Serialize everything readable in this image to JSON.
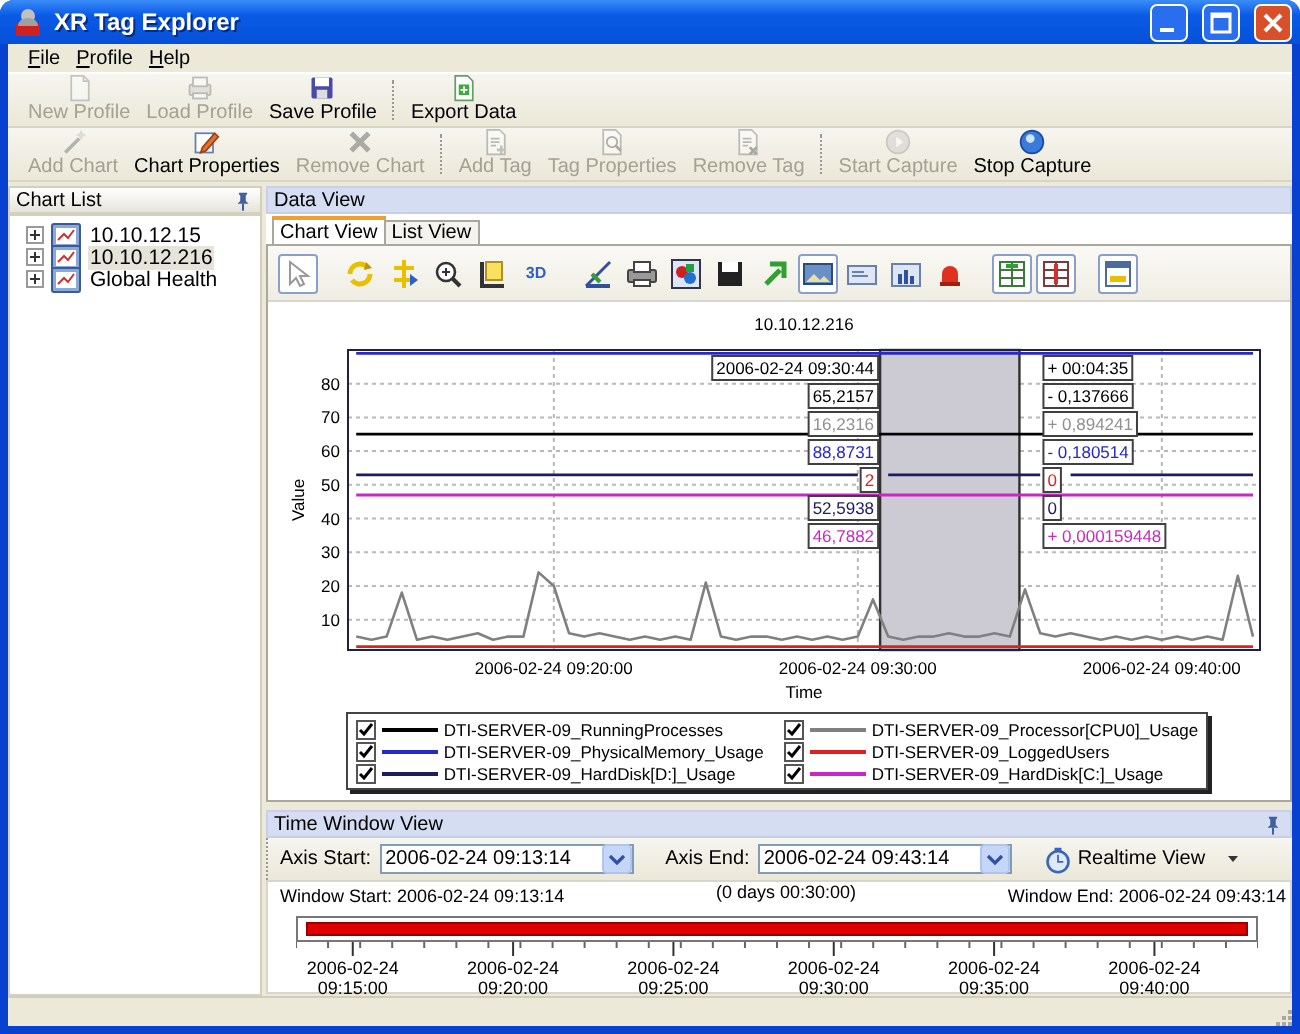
{
  "window": {
    "title": "XR Tag Explorer"
  },
  "menu": [
    "File",
    "Profile",
    "Help"
  ],
  "toolbar_profile": [
    [
      {
        "label": "New Profile",
        "kind": "doc",
        "disabled": true
      },
      {
        "label": "Load Profile",
        "kind": "tray",
        "disabled": true
      },
      {
        "label": "Save Profile",
        "kind": "save",
        "disabled": false
      }
    ],
    [
      {
        "label": "Export Data",
        "kind": "export",
        "disabled": false
      }
    ]
  ],
  "toolbar_chart": [
    [
      {
        "label": "Add Chart",
        "kind": "wand",
        "disabled": true
      },
      {
        "label": "Chart Properties",
        "kind": "pencil",
        "disabled": false
      },
      {
        "label": "Remove Chart",
        "kind": "remove",
        "disabled": true
      }
    ],
    [
      {
        "label": "Add Tag",
        "kind": "tagadd",
        "disabled": true
      },
      {
        "label": "Tag Properties",
        "kind": "tagprops",
        "disabled": true
      },
      {
        "label": "Remove Tag",
        "kind": "tagremove",
        "disabled": true
      }
    ],
    [
      {
        "label": "Start Capture",
        "kind": "start",
        "disabled": true
      },
      {
        "label": "Stop Capture",
        "kind": "stop",
        "disabled": false
      }
    ]
  ],
  "chart_list": {
    "title": "Chart List",
    "items": [
      {
        "label": "10.10.12.15",
        "expanded": false,
        "selected": false
      },
      {
        "label": "10.10.12.216",
        "expanded": false,
        "selected": true
      },
      {
        "label": "Global Health",
        "expanded": false,
        "selected": false
      }
    ]
  },
  "data_view": {
    "title": "Data View",
    "tabs": [
      {
        "label": "Chart View",
        "selected": true
      },
      {
        "label": "List View",
        "selected": false
      }
    ],
    "chart_toolbar": [
      [
        {
          "kind": "pointer",
          "pressed": true
        }
      ],
      [
        {
          "kind": "refresh",
          "pressed": false
        },
        {
          "kind": "move",
          "pressed": false
        },
        {
          "kind": "zoom",
          "pressed": false
        },
        {
          "kind": "frame",
          "pressed": false
        },
        {
          "kind": "text",
          "label": "3D",
          "pressed": false
        }
      ],
      [
        {
          "kind": "ruler",
          "pressed": false
        },
        {
          "kind": "printer",
          "pressed": false
        },
        {
          "kind": "palette",
          "pressed": false
        },
        {
          "kind": "save",
          "pressed": false
        },
        {
          "kind": "arrow",
          "pressed": false
        },
        {
          "kind": "image",
          "pressed": true
        },
        {
          "kind": "card",
          "pressed": false
        },
        {
          "kind": "bars",
          "pressed": false
        },
        {
          "kind": "alarm",
          "pressed": false
        }
      ],
      [
        {
          "kind": "splitgreen",
          "pressed": true
        },
        {
          "kind": "splitred",
          "pressed": true
        }
      ],
      [
        {
          "kind": "window",
          "pressed": true
        }
      ]
    ],
    "chart_data": {
      "type": "line",
      "title": "10.10.12.216",
      "xlabel": "Time",
      "ylabel": "Value",
      "categories": [
        null,
        null,
        null,
        null,
        null,
        null,
        null,
        null,
        null,
        null,
        null,
        null,
        null,
        "2006-02-24 09:20:00",
        null,
        null,
        null,
        null,
        null,
        null,
        null,
        null,
        null,
        null,
        null,
        null,
        null,
        null,
        null,
        null,
        null,
        null,
        null,
        "2006-02-24 09:30:00",
        null,
        null,
        null,
        null,
        null,
        null,
        null,
        null,
        null,
        null,
        null,
        null,
        null,
        null,
        null,
        null,
        null,
        null,
        null,
        "2006-02-24 09:40:00",
        null,
        null,
        null,
        null,
        null,
        null
      ],
      "series": [
        {
          "name": "DTI-SERVER-09_RunningProcesses",
          "color": "#000000",
          "values": [
            65,
            65,
            65,
            65,
            65,
            65,
            65,
            65,
            65,
            65,
            65,
            65,
            65,
            65,
            65,
            65,
            65,
            65,
            65,
            65,
            65,
            65,
            65,
            65,
            65,
            65,
            65,
            65,
            65,
            65,
            65,
            65,
            65,
            null,
            65,
            65,
            65,
            65,
            65,
            65,
            65,
            65,
            65,
            65,
            65,
            65,
            65,
            65,
            65,
            65,
            65,
            65,
            65,
            65,
            65,
            65,
            65,
            65,
            65,
            65
          ]
        },
        {
          "name": "DTI-SERVER-09_Processor[CPU0]_Usage",
          "color": "#808080",
          "values": [
            5,
            4,
            5,
            18,
            4,
            5,
            4,
            5,
            6,
            4,
            5,
            5,
            24,
            20,
            6,
            5,
            6,
            5,
            4,
            5,
            4,
            5,
            4,
            21,
            5,
            4,
            5,
            5,
            4,
            5,
            4,
            5,
            4,
            5,
            16,
            5,
            4,
            5,
            5,
            6,
            5,
            5,
            6,
            5,
            19,
            6,
            5,
            6,
            5,
            4,
            5,
            4,
            5,
            4,
            5,
            4,
            5,
            4,
            23,
            5
          ]
        },
        {
          "name": "DTI-SERVER-09_PhysicalMemory_Usage",
          "color": "#2828c8",
          "values": [
            89,
            89,
            89,
            89,
            89,
            89,
            89,
            89,
            89,
            89,
            89,
            89,
            89,
            89,
            89,
            89,
            89,
            89,
            89,
            89,
            89,
            89,
            89,
            89,
            89,
            89,
            89,
            89,
            89,
            89,
            89,
            89,
            89,
            89,
            89,
            89,
            89,
            89,
            89,
            89,
            89,
            89,
            89,
            89,
            89,
            89,
            89,
            89,
            89,
            89,
            89,
            89,
            89,
            89,
            89,
            89,
            89,
            89,
            89,
            89
          ]
        },
        {
          "name": "DTI-SERVER-09_LoggedUsers",
          "color": "#e02020",
          "values": [
            2,
            2,
            2,
            2,
            2,
            2,
            2,
            2,
            2,
            2,
            2,
            2,
            2,
            2,
            2,
            2,
            2,
            2,
            2,
            2,
            2,
            2,
            2,
            2,
            2,
            2,
            2,
            2,
            2,
            2,
            2,
            2,
            2,
            2,
            2,
            2,
            2,
            2,
            2,
            2,
            2,
            2,
            2,
            2,
            2,
            2,
            2,
            2,
            2,
            2,
            2,
            2,
            2,
            2,
            2,
            2,
            2,
            2,
            2,
            2
          ]
        },
        {
          "name": "DTI-SERVER-09_HardDisk[D:]_Usage",
          "color": "#1c1c60",
          "values": [
            53,
            53,
            53,
            53,
            53,
            53,
            53,
            53,
            53,
            53,
            53,
            53,
            53,
            53,
            53,
            53,
            53,
            53,
            53,
            53,
            53,
            53,
            53,
            53,
            53,
            53,
            53,
            53,
            53,
            53,
            53,
            53,
            53,
            53,
            null,
            53,
            53,
            53,
            53,
            53,
            53,
            53,
            53,
            53,
            53,
            53,
            null,
            53,
            53,
            53,
            53,
            53,
            53,
            53,
            53,
            53,
            53,
            53,
            53,
            53
          ]
        },
        {
          "name": "DTI-SERVER-09_HardDisk[C:]_Usage",
          "color": "#c828c8",
          "values": [
            47,
            47,
            47,
            47,
            47,
            47,
            47,
            47,
            47,
            47,
            47,
            47,
            47,
            47,
            47,
            47,
            47,
            47,
            47,
            47,
            47,
            47,
            47,
            47,
            47,
            47,
            47,
            47,
            47,
            47,
            47,
            47,
            47,
            47,
            47,
            47,
            47,
            47,
            47,
            47,
            47,
            47,
            47,
            47,
            47,
            47,
            47,
            47,
            47,
            47,
            47,
            47,
            47,
            47,
            47,
            47,
            47,
            47,
            47,
            47
          ]
        }
      ],
      "ylim": [
        1,
        90
      ],
      "yticks": [
        10,
        20,
        30,
        40,
        50,
        60,
        70,
        80
      ],
      "grid": true,
      "legend": "bottom"
    },
    "cursor": {
      "time": "2006-02-24 09:30:44",
      "delta": "+ 00:04:35",
      "readings": [
        {
          "value": "65,2157",
          "change": "- 0,137666",
          "color": "#000000"
        },
        {
          "value": "16,2316",
          "change": "+ 0,894241",
          "color": "#909090"
        },
        {
          "value": "88,8731",
          "change": "- 0,180514",
          "color": "#2828c8"
        },
        {
          "value": "2",
          "change": "0",
          "color": "#e02020"
        },
        {
          "value": "52,5938",
          "change": "0",
          "color": "#1c1c60"
        },
        {
          "value": "46,7882",
          "change": "+ 0,000159448",
          "color": "#c828c8"
        }
      ]
    },
    "legend": [
      {
        "checked": true
      },
      {
        "checked": true
      },
      {
        "checked": true
      },
      {
        "checked": true
      },
      {
        "checked": true
      },
      {
        "checked": true
      }
    ]
  },
  "time_window": {
    "title": "Time Window View",
    "axis_start": {
      "label": "Axis Start:",
      "value": "2006-02-24 09:13:14"
    },
    "axis_end": {
      "label": "Axis End:",
      "value": "2006-02-24 09:43:14"
    },
    "realtime": "Realtime View",
    "window_start": "Window Start: 2006-02-24 09:13:14",
    "duration": "(0 days 00:30:00)",
    "window_end": "Window End: 2006-02-24 09:43:14",
    "ticks": [
      {
        "date": "2006-02-24",
        "time": "09:15:00"
      },
      {
        "date": "2006-02-24",
        "time": "09:20:00"
      },
      {
        "date": "2006-02-24",
        "time": "09:25:00"
      },
      {
        "date": "2006-02-24",
        "time": "09:30:00"
      },
      {
        "date": "2006-02-24",
        "time": "09:35:00"
      },
      {
        "date": "2006-02-24",
        "time": "09:40:00"
      }
    ]
  }
}
